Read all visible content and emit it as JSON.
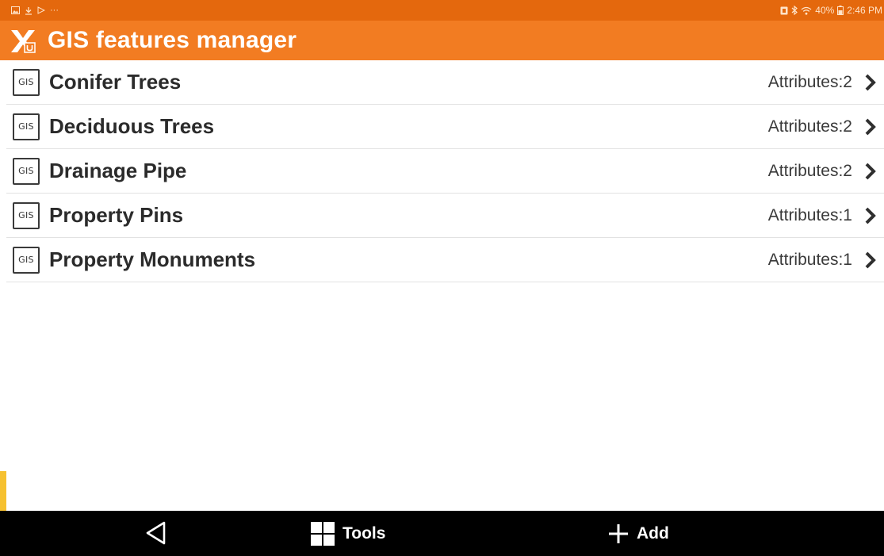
{
  "status_bar": {
    "left_icons": [
      "image-icon",
      "download-icon",
      "play-icon",
      "more-icon"
    ],
    "right_icons": [
      "nfc-icon",
      "bluetooth-icon",
      "wifi-icon"
    ],
    "battery": "40%",
    "time": "2:46 PM"
  },
  "header": {
    "title": "GIS features manager",
    "logo_icon": "app-logo-icon"
  },
  "features": [
    {
      "icon_label": "GIS",
      "name": "Conifer Trees",
      "attributes": "Attributes:2"
    },
    {
      "icon_label": "GIS",
      "name": "Deciduous Trees",
      "attributes": "Attributes:2"
    },
    {
      "icon_label": "GIS",
      "name": "Drainage Pipe",
      "attributes": "Attributes:2"
    },
    {
      "icon_label": "GIS",
      "name": "Property Pins",
      "attributes": "Attributes:1"
    },
    {
      "icon_label": "GIS",
      "name": "Property Monuments",
      "attributes": "Attributes:1"
    }
  ],
  "bottom_bar": {
    "tools_label": "Tools",
    "add_label": "Add"
  },
  "colors": {
    "status_bar": "#e4680d",
    "header": "#f27c22",
    "bottom_bar": "#000000"
  }
}
